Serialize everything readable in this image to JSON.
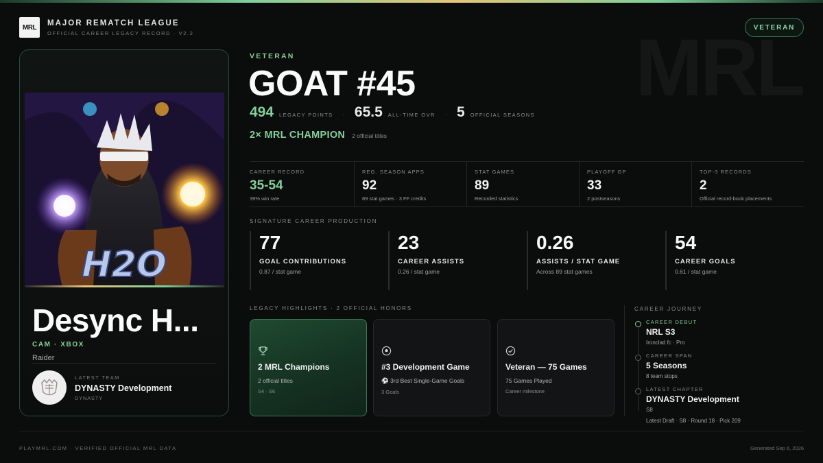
{
  "brand": {
    "logo_text": "MRL",
    "title": "MAJOR REMATCH LEAGUE",
    "subtitle": "OFFICIAL CAREER LEGACY RECORD · V2.2",
    "tier_pill": "VETERAN",
    "watermark": "MRL"
  },
  "player": {
    "name": "Desync H...",
    "positions": "CAM · XBOX",
    "role": "Raider",
    "art_text": "H2O",
    "latest_team_caption": "LATEST TEAM",
    "latest_team": "DYNASTY Development",
    "latest_team_tag": "DYNASTY"
  },
  "hero": {
    "tier": "VETERAN",
    "goat_rank": "GOAT #45",
    "legacy_points": "494",
    "legacy_points_label": "LEGACY POINTS",
    "ovr": "65.5",
    "ovr_label": "ALL-TIME OVR",
    "seasons": "5",
    "seasons_label": "OFFICIAL SEASONS",
    "champion": "2× MRL CHAMPION",
    "champion_sub": "2 official titles"
  },
  "stats": [
    {
      "caption": "CAREER RECORD",
      "value": "35-54",
      "sub": "39% win rate"
    },
    {
      "caption": "REG. SEASON APPS",
      "value": "92",
      "sub": "89 stat games · 3 FF credits"
    },
    {
      "caption": "STAT GAMES",
      "value": "89",
      "sub": "Recorded statistics"
    },
    {
      "caption": "PLAYOFF GP",
      "value": "33",
      "sub": "2 postseasons"
    },
    {
      "caption": "TOP-3 RECORDS",
      "value": "2",
      "sub": "Official record-book placements"
    }
  ],
  "signature": {
    "caption": "SIGNATURE CAREER PRODUCTION",
    "items": [
      {
        "value": "77",
        "label": "GOAL CONTRIBUTIONS",
        "sub": "0.87 / stat game"
      },
      {
        "value": "23",
        "label": "CAREER ASSISTS",
        "sub": "0.26 / stat game"
      },
      {
        "value": "0.26",
        "label": "ASSISTS / STAT GAME",
        "sub": "Across 89 stat games"
      },
      {
        "value": "54",
        "label": "CAREER GOALS",
        "sub": "0.61 / stat game"
      }
    ]
  },
  "highlights": {
    "caption": "LEGACY HIGHLIGHTS · 2 OFFICIAL HONORS",
    "items": [
      {
        "icon": "trophy-icon",
        "title": "2 MRL Champions",
        "sub": "2 official titles",
        "detail": "S4 · S6"
      },
      {
        "icon": "soccer-ball-icon",
        "title": "#3 Development Game",
        "sub": "⚽ 3rd Best Single-Game Goals",
        "detail": "3 Goals"
      },
      {
        "icon": "check-circle-icon",
        "title": "Veteran — 75 Games",
        "sub": "75 Games Played",
        "detail": "Career milestone"
      }
    ]
  },
  "journey": {
    "caption": "CAREER JOURNEY",
    "items": [
      {
        "key": "CAREER DEBUT",
        "value": "NRL S3",
        "detail": "Ironclad fc · Pro"
      },
      {
        "key": "CAREER SPAN",
        "value": "5 Seasons",
        "detail": "8 team stops"
      },
      {
        "key": "LATEST CHAPTER",
        "value": "DYNASTY Development",
        "detail": "S8",
        "detail2": "Latest Draft · S8 · Round 18 · Pick 209"
      }
    ]
  },
  "footer": {
    "left": "PLAYMRL.COM · VERIFIED OFFICIAL MRL DATA",
    "right": "Generated Sep 6, 2026"
  },
  "colors": {
    "accent_green": "#86cf9d",
    "gold": "#e6c57a",
    "background": "#0b0c0c"
  }
}
